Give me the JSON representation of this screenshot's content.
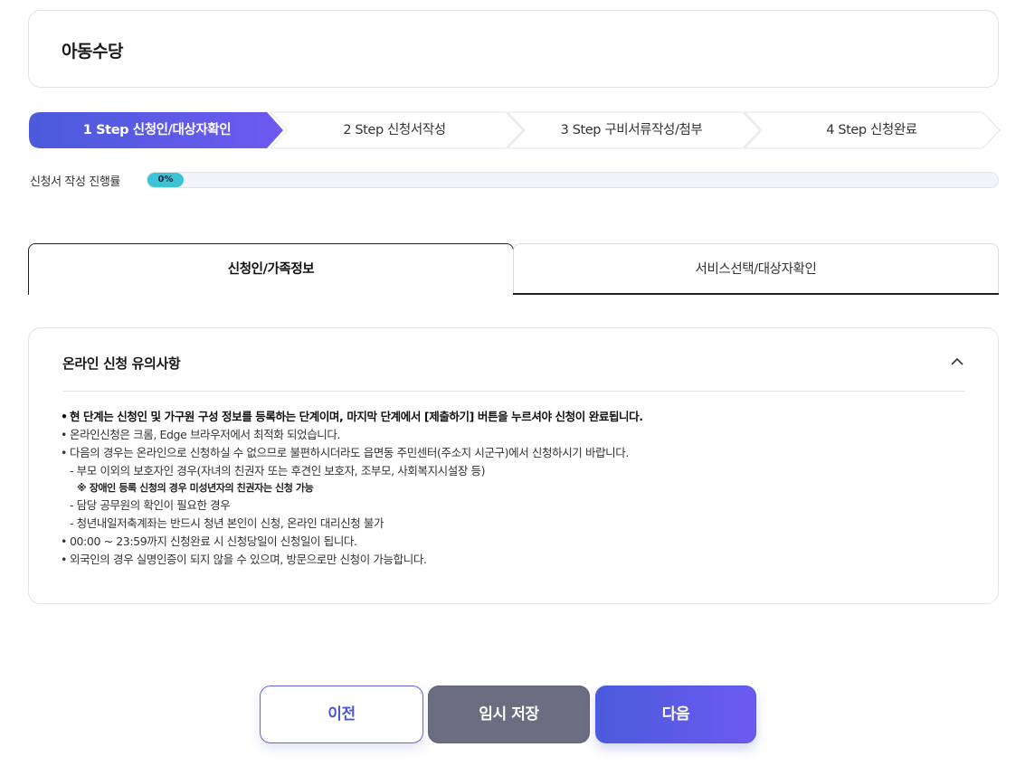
{
  "page": {
    "title": "아동수당"
  },
  "steps": [
    {
      "label": "1 Step 신청인/대상자확인",
      "active": true
    },
    {
      "label": "2 Step 신청서작성",
      "active": false
    },
    {
      "label": "3 Step 구비서류작성/첨부",
      "active": false
    },
    {
      "label": "4 Step 신청완료",
      "active": false
    }
  ],
  "progress": {
    "label": "신청서 작성 진행률",
    "value_text": "0%",
    "value": 0
  },
  "tabs": [
    {
      "label": "신청인/가족정보",
      "active": true
    },
    {
      "label": "서비스선택/대상자확인",
      "active": false
    }
  ],
  "notice": {
    "title": "온라인 신청 유의사항",
    "lines": [
      {
        "type": "bold",
        "text": "현 단계는 신청인 및 가구원 구성 정보를 등록하는 단계이며, 마지막 단계에서 [제출하기] 버튼을 누르셔야 신청이 완료됩니다."
      },
      {
        "type": "bullet",
        "text": "온라인신청은 크롬, Edge 브라우저에서 최적화 되었습니다."
      },
      {
        "type": "bullet",
        "text": "다음의 경우는 온라인으로 신청하실 수 없으므로 불편하시더라도 읍면동 주민센터(주소지 시군구)에서 신청하시기 바랍니다."
      },
      {
        "type": "sub",
        "text": "- 부모 이외의 보호자인 경우(자녀의 친권자 또는 후견인 보호자, 조부모, 사회복지시설장 등)"
      },
      {
        "type": "note",
        "text": "※ 장애인 등록 신청의 경우 미성년자의 친권자는 신청 가능"
      },
      {
        "type": "sub",
        "text": "- 담당 공무원의 확인이 필요한 경우"
      },
      {
        "type": "sub",
        "text": "- 청년내일저축계좌는 반드시 청년 본인이 신청, 온라인 대리신청 불가"
      },
      {
        "type": "bullet",
        "text": "00:00 ~ 23:59까지 신청완료 시 신청당일이 신청일이 됩니다."
      },
      {
        "type": "bullet",
        "text": "외국인의 경우 실명인증이 되지 않을 수 있으며, 방문으로만 신청이 가능합니다."
      }
    ]
  },
  "buttons": {
    "prev": "이전",
    "temp_save": "임시 저장",
    "next": "다음"
  },
  "colors": {
    "accent_start": "#4b5bdc",
    "accent_end": "#6d5af0",
    "progress": "#3cc4d6",
    "temp_button": "#6b6e80"
  }
}
